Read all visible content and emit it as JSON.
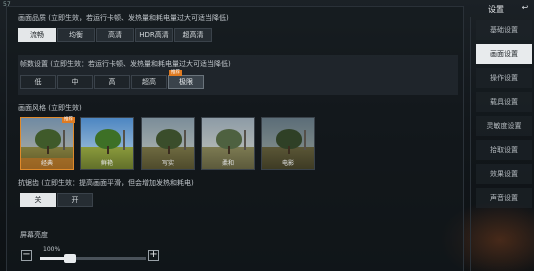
{
  "fps": "57",
  "quality": {
    "title": "画面品质 (立即生效，若运行卡顿、发热量和耗电量过大可适当降低)",
    "options": [
      "流畅",
      "均衡",
      "高清",
      "HDR高清",
      "超高清"
    ],
    "selected": "流畅"
  },
  "framerate": {
    "title": "帧数设置 (立即生效：若运行卡顿、发热量和耗电量过大可适当降低)",
    "options": [
      "低",
      "中",
      "高",
      "超高",
      "极限"
    ],
    "selected": "极限",
    "badge": "推荐"
  },
  "style": {
    "title": "画面风格 (立即生效)",
    "options": [
      "经典",
      "鲜艳",
      "写实",
      "柔和",
      "电影"
    ],
    "selected": "经典",
    "badge": "推荐"
  },
  "antialias": {
    "title": "抗锯齿 (立即生效：提高画面平滑，但会增加发热和耗电)",
    "options": [
      "关",
      "开"
    ],
    "selected": "关"
  },
  "brightness": {
    "title": "屏幕亮度",
    "value_label": "100%",
    "value": 1.0,
    "minus": "−",
    "plus": "+"
  },
  "sidebar": {
    "title": "设置",
    "close": "↩",
    "items": [
      "基础设置",
      "画面设置",
      "操作设置",
      "载具设置",
      "灵敏度设置",
      "拾取设置",
      "效果设置",
      "声音设置"
    ],
    "active": "画面设置"
  },
  "colors": {
    "accent": "#e07b21",
    "selected_bg": "#e4e7e9"
  }
}
